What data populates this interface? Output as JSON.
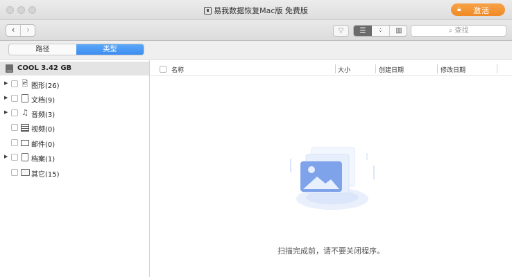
{
  "window": {
    "title": "易我数据恢复Mac版 免费版",
    "activate_label": "激活"
  },
  "toolbar": {
    "back_glyph": "‹",
    "forward_glyph": "›",
    "search_placeholder": "查找"
  },
  "segments": {
    "path_label": "路径",
    "type_label": "类型",
    "selected": "类型"
  },
  "sidebar": {
    "drive_label": "COOL 3.42 GB",
    "items": [
      {
        "label": "图形(26)",
        "icon": "image-file-icon",
        "expandable": true
      },
      {
        "label": "文档(9)",
        "icon": "document-icon",
        "expandable": true
      },
      {
        "label": "音频(3)",
        "icon": "music-note-icon",
        "expandable": true
      },
      {
        "label": "视频(0)",
        "icon": "film-icon",
        "expandable": false
      },
      {
        "label": "邮件(0)",
        "icon": "mail-icon",
        "expandable": false
      },
      {
        "label": "档案(1)",
        "icon": "archive-icon",
        "expandable": true
      },
      {
        "label": "其它(15)",
        "icon": "folder-icon",
        "expandable": false
      }
    ]
  },
  "table": {
    "columns": [
      "名称",
      "大小",
      "创建日期",
      "修改日期"
    ]
  },
  "empty_state": {
    "message": "扫描完成前，请不要关闭程序。"
  },
  "colors": {
    "accent_orange": "#f08a25",
    "selected_blue": "#3d8ef0",
    "illustration_blue": "#6f9ae8"
  }
}
